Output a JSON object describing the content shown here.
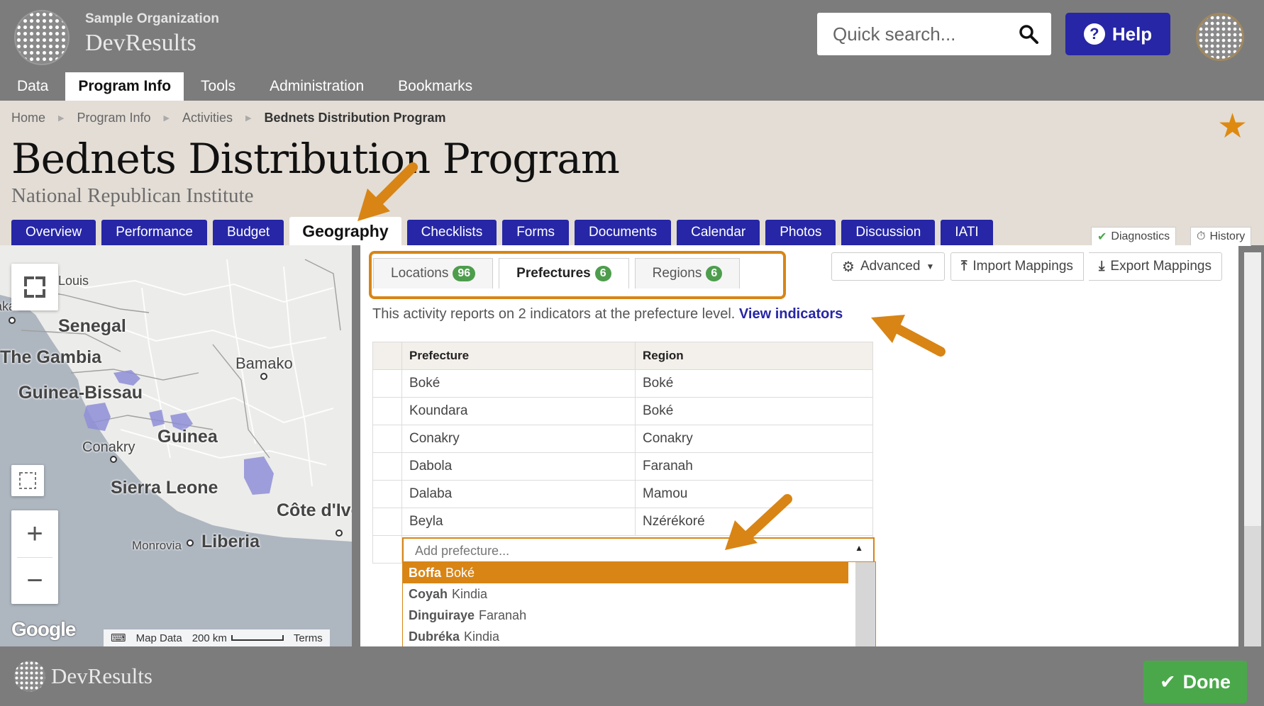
{
  "org": {
    "name": "Sample Organization",
    "app": "DevResults"
  },
  "search": {
    "placeholder": "Quick search..."
  },
  "help": {
    "label": "Help"
  },
  "topnav": [
    "Data",
    "Program Info",
    "Tools",
    "Administration",
    "Bookmarks"
  ],
  "breadcrumb": [
    "Home",
    "Program Info",
    "Activities",
    "Bednets Distribution Program"
  ],
  "page": {
    "title": "Bednets Distribution Program",
    "subtitle": "National Republican Institute"
  },
  "tabs": [
    "Overview",
    "Performance",
    "Budget",
    "Geography",
    "Checklists",
    "Forms",
    "Documents",
    "Calendar",
    "Photos",
    "Discussion",
    "IATI"
  ],
  "side_buttons": {
    "diagnostics": "Diagnostics",
    "history": "History"
  },
  "map": {
    "labels": [
      "Louis",
      "Dakar",
      "Senegal",
      "The Gambia",
      "Bamako",
      "Guinea-Bissau",
      "Guinea",
      "Conakry",
      "Sierra Leone",
      "Côte d'Ivoire",
      "Monrovia",
      "Liberia"
    ],
    "footer": {
      "map_data": "Map Data",
      "scale": "200 km",
      "terms": "Terms"
    },
    "brand": "Google"
  },
  "subtabs": [
    {
      "label": "Locations",
      "count": "96"
    },
    {
      "label": "Prefectures",
      "count": "6"
    },
    {
      "label": "Regions",
      "count": "6"
    }
  ],
  "toolbar": {
    "advanced": "Advanced",
    "import": "Import Mappings",
    "export": "Export Mappings"
  },
  "info": {
    "text": "This activity reports on 2 indicators at the prefecture level.",
    "link": "View indicators"
  },
  "table": {
    "headers": [
      "Prefecture",
      "Region"
    ],
    "rows": [
      [
        "Boké",
        "Boké"
      ],
      [
        "Koundara",
        "Boké"
      ],
      [
        "Conakry",
        "Conakry"
      ],
      [
        "Dabola",
        "Faranah"
      ],
      [
        "Dalaba",
        "Mamou"
      ],
      [
        "Beyla",
        "Nzérékoré"
      ]
    ]
  },
  "add_prefecture": {
    "placeholder": "Add prefecture..."
  },
  "dropdown": [
    {
      "name": "Boffa",
      "region": "Boké"
    },
    {
      "name": "Coyah",
      "region": "Kindia"
    },
    {
      "name": "Dinguiraye",
      "region": "Faranah"
    },
    {
      "name": "Dubréka",
      "region": "Kindia"
    }
  ],
  "footer": {
    "app": "DevResults",
    "done": "Done"
  },
  "colors": {
    "brand_blue": "#2626a6",
    "accent_orange": "#d88515",
    "success_green": "#4aa84a",
    "header_gray": "#7c7c7c",
    "beige": "#e3ddd5"
  }
}
